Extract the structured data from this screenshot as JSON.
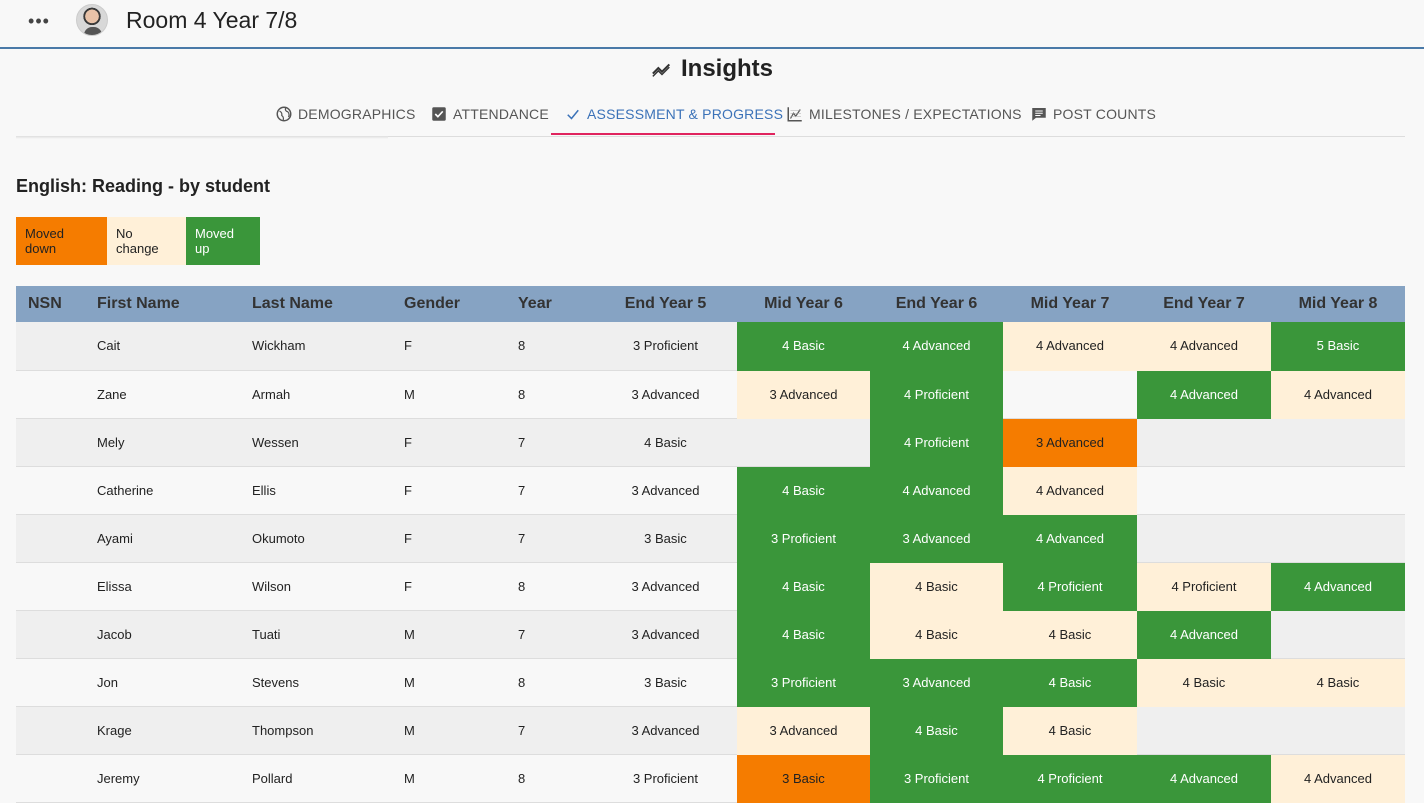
{
  "header": {
    "menu_icon": "more-horizontal-icon",
    "title": "Room 4 Year 7/8"
  },
  "page": {
    "title": "Insights",
    "title_icon": "trending-icon"
  },
  "tabs": [
    {
      "label": "DEMOGRAPHICS",
      "icon": "globe-icon",
      "active": false
    },
    {
      "label": "ATTENDANCE",
      "icon": "checkbox-icon",
      "active": false
    },
    {
      "label": "ASSESSMENT & PROGRESS",
      "icon": "checkmark-icon",
      "active": true
    },
    {
      "label": "MILESTONES / EXPECTATIONS",
      "icon": "chart-icon",
      "active": false
    },
    {
      "label": "POST COUNTS",
      "icon": "comment-icon",
      "active": false
    }
  ],
  "section_title": "English: Reading - by student",
  "legend": {
    "moved_down": "Moved down",
    "no_change": "No change",
    "moved_up": "Moved up"
  },
  "colors": {
    "moved_down": "#f57c00",
    "no_change": "#fff0d8",
    "moved_up": "#3a963a",
    "header": "#86a3c3",
    "active_tab": "#3b72b8",
    "tab_underline": "#e0245e"
  },
  "table": {
    "columns": [
      "NSN",
      "First Name",
      "Last Name",
      "Gender",
      "Year",
      "End Year 5",
      "Mid Year 6",
      "End Year 6",
      "Mid Year 7",
      "End Year 7",
      "Mid Year 8"
    ],
    "rows": [
      {
        "nsn": "",
        "first": "Cait",
        "last": "Wickham",
        "gender": "F",
        "year": "8",
        "periods": [
          {
            "v": "3 Proficient",
            "s": ""
          },
          {
            "v": "4 Basic",
            "s": "up"
          },
          {
            "v": "4 Advanced",
            "s": "up"
          },
          {
            "v": "4 Advanced",
            "s": "same"
          },
          {
            "v": "4 Advanced",
            "s": "same"
          },
          {
            "v": "5 Basic",
            "s": "up"
          }
        ]
      },
      {
        "nsn": "",
        "first": "Zane",
        "last": "Armah",
        "gender": "M",
        "year": "8",
        "periods": [
          {
            "v": "3 Advanced",
            "s": ""
          },
          {
            "v": "3 Advanced",
            "s": "same"
          },
          {
            "v": "4 Proficient",
            "s": "up"
          },
          {
            "v": "",
            "s": ""
          },
          {
            "v": "4 Advanced",
            "s": "up"
          },
          {
            "v": "4 Advanced",
            "s": "same"
          }
        ]
      },
      {
        "nsn": "",
        "first": "Mely",
        "last": "Wessen",
        "gender": "F",
        "year": "7",
        "periods": [
          {
            "v": "4 Basic",
            "s": ""
          },
          {
            "v": "",
            "s": ""
          },
          {
            "v": "4 Proficient",
            "s": "up"
          },
          {
            "v": "3 Advanced",
            "s": "down"
          },
          {
            "v": "",
            "s": ""
          },
          {
            "v": "",
            "s": ""
          }
        ]
      },
      {
        "nsn": "",
        "first": "Catherine",
        "last": "Ellis",
        "gender": "F",
        "year": "7",
        "periods": [
          {
            "v": "3 Advanced",
            "s": ""
          },
          {
            "v": "4 Basic",
            "s": "up"
          },
          {
            "v": "4 Advanced",
            "s": "up"
          },
          {
            "v": "4 Advanced",
            "s": "same"
          },
          {
            "v": "",
            "s": ""
          },
          {
            "v": "",
            "s": ""
          }
        ]
      },
      {
        "nsn": "",
        "first": "Ayami",
        "last": "Okumoto",
        "gender": "F",
        "year": "7",
        "periods": [
          {
            "v": "3 Basic",
            "s": ""
          },
          {
            "v": "3 Proficient",
            "s": "up"
          },
          {
            "v": "3 Advanced",
            "s": "up"
          },
          {
            "v": "4 Advanced",
            "s": "up"
          },
          {
            "v": "",
            "s": ""
          },
          {
            "v": "",
            "s": ""
          }
        ]
      },
      {
        "nsn": "",
        "first": "Elissa",
        "last": "Wilson",
        "gender": "F",
        "year": "8",
        "periods": [
          {
            "v": "3 Advanced",
            "s": ""
          },
          {
            "v": "4 Basic",
            "s": "up"
          },
          {
            "v": "4 Basic",
            "s": "same"
          },
          {
            "v": "4 Proficient",
            "s": "up"
          },
          {
            "v": "4 Proficient",
            "s": "same"
          },
          {
            "v": "4 Advanced",
            "s": "up"
          }
        ]
      },
      {
        "nsn": "",
        "first": "Jacob",
        "last": "Tuati",
        "gender": "M",
        "year": "7",
        "periods": [
          {
            "v": "3 Advanced",
            "s": ""
          },
          {
            "v": "4 Basic",
            "s": "up"
          },
          {
            "v": "4 Basic",
            "s": "same"
          },
          {
            "v": "4 Basic",
            "s": "same"
          },
          {
            "v": "4 Advanced",
            "s": "up"
          },
          {
            "v": "",
            "s": ""
          }
        ]
      },
      {
        "nsn": "",
        "first": "Jon",
        "last": "Stevens",
        "gender": "M",
        "year": "8",
        "periods": [
          {
            "v": "3 Basic",
            "s": ""
          },
          {
            "v": "3 Proficient",
            "s": "up"
          },
          {
            "v": "3 Advanced",
            "s": "up"
          },
          {
            "v": "4 Basic",
            "s": "up"
          },
          {
            "v": "4 Basic",
            "s": "same"
          },
          {
            "v": "4 Basic",
            "s": "same"
          }
        ]
      },
      {
        "nsn": "",
        "first": "Krage",
        "last": "Thompson",
        "gender": "M",
        "year": "7",
        "periods": [
          {
            "v": "3 Advanced",
            "s": ""
          },
          {
            "v": "3 Advanced",
            "s": "same"
          },
          {
            "v": "4 Basic",
            "s": "up"
          },
          {
            "v": "4 Basic",
            "s": "same"
          },
          {
            "v": "",
            "s": ""
          },
          {
            "v": "",
            "s": ""
          }
        ]
      },
      {
        "nsn": "",
        "first": "Jeremy",
        "last": "Pollard",
        "gender": "M",
        "year": "8",
        "periods": [
          {
            "v": "3 Proficient",
            "s": ""
          },
          {
            "v": "3 Basic",
            "s": "down"
          },
          {
            "v": "3 Proficient",
            "s": "up"
          },
          {
            "v": "4 Proficient",
            "s": "up"
          },
          {
            "v": "4 Advanced",
            "s": "up"
          },
          {
            "v": "4 Advanced",
            "s": "same"
          }
        ]
      }
    ]
  }
}
